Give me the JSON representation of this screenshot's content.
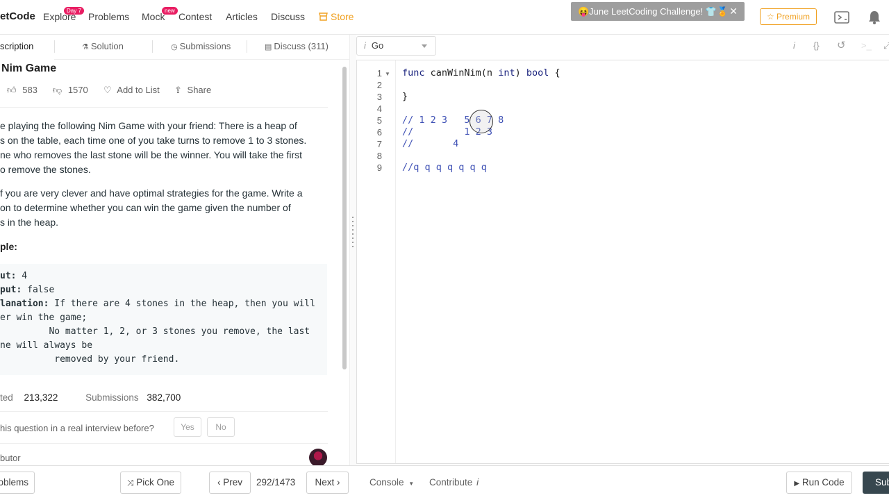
{
  "nav": {
    "logo_text": "etCode",
    "items": [
      {
        "label": "Explore",
        "badge": "Day 7"
      },
      {
        "label": "Problems"
      },
      {
        "label": "Mock",
        "badge": "new"
      },
      {
        "label": "Contest"
      },
      {
        "label": "Articles"
      },
      {
        "label": "Discuss"
      },
      {
        "label": "Store"
      }
    ],
    "challenge_banner": "😝June LeetCoding Challenge! 👕🏅",
    "premium_label": "☆ Premium",
    "icons": [
      "playground-icon",
      "bell-icon"
    ],
    "accent_color": "#f0a020"
  },
  "tabs": {
    "description": "scription",
    "solution": "Solution",
    "submissions": "Submissions",
    "discuss": "Discuss (311)"
  },
  "problem": {
    "title": "Nim Game",
    "likes": "583",
    "dislikes": "1570",
    "add_to_list": "Add to List",
    "share": "Share",
    "para1": [
      "e playing the following Nim Game with your friend: There is a heap of",
      "s on the table, each time one of you take turns to remove 1 to 3 stones.",
      "ne who removes the last stone will be the winner. You will take the first",
      "o remove the stones."
    ],
    "para2": [
      "f you are very clever and have optimal strategies for the game. Write a",
      "on to determine whether you can win the game given the number of",
      "s in the heap."
    ],
    "example_heading": "ple:",
    "example": {
      "input_label": "ut:",
      "input_value": " 4",
      "output_label": "put:",
      "output_value": " false",
      "explanation_label": "lanation:",
      "explanation_value": " If there are 4 stones in the heap, then you will",
      "line4": "er win the game;",
      "line5": "         No matter 1, 2, or 3 stones you remove, the last",
      "line6": "ne will always be",
      "line7": "          removed by your friend."
    },
    "accepted_label": "ted",
    "accepted_value": "213,322",
    "submissions_label": "Submissions",
    "submissions_value": "382,700",
    "interview_question": "his question in a real interview before?",
    "yes": "Yes",
    "no": "No",
    "contributor": "butor"
  },
  "editor": {
    "language": "Go",
    "language_icon_text": "i",
    "header_icons": {
      "info": "i",
      "braces": "{}"
    },
    "line_numbers": [
      "1",
      "2",
      "3",
      "4",
      "5",
      "6",
      "7",
      "8",
      "9"
    ],
    "lines": [
      "func canWinNim(n int) bool {",
      "",
      "}",
      "",
      "// 1 2 3   5 6 7 8",
      "//         1 2 3",
      "//       4",
      "",
      "//q q q q q q q"
    ]
  },
  "bottom": {
    "problems": "oblems",
    "pick_one": "Pick One",
    "prev": "Prev",
    "page": "292/1473",
    "next": "Next",
    "console": "Console",
    "contribute": "Contribute",
    "run_code": "Run Code",
    "submit": "Sub"
  }
}
